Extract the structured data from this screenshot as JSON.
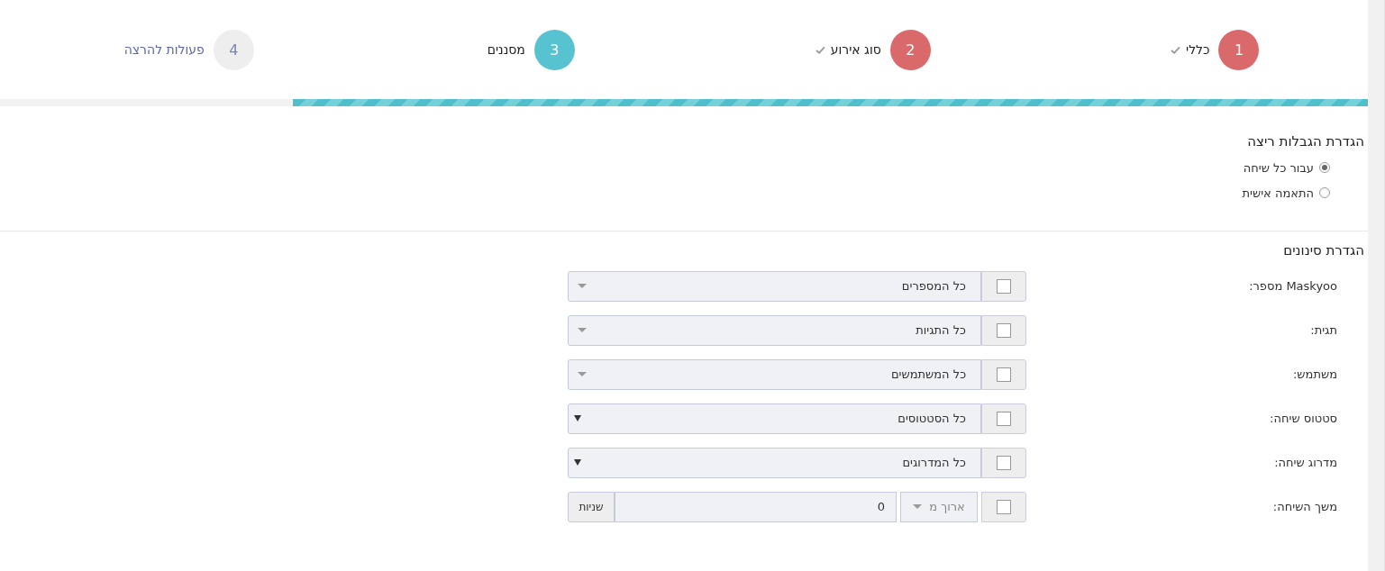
{
  "steps": [
    {
      "number": "1",
      "label": "כללי",
      "done": true,
      "selected": false
    },
    {
      "number": "2",
      "label": "סוג אירוע",
      "done": true,
      "selected": false
    },
    {
      "number": "3",
      "label": "מסננים",
      "done": false,
      "selected": true
    },
    {
      "number": "4",
      "label": "פעולות להרצה",
      "done": false,
      "selected": false
    }
  ],
  "progress": {
    "level": 0.786
  },
  "run_limits": {
    "title": "הגדרת הגבלות ריצה",
    "options": [
      {
        "label": "עבור כל שיחה",
        "selected": true
      },
      {
        "label": "התאמה אישית",
        "selected": false
      }
    ]
  },
  "filters": {
    "title": "הגדרת סינונים",
    "rows": [
      {
        "kind": "select",
        "label": "Maskyoo מספר:",
        "checked": false,
        "value": "כל המספרים"
      },
      {
        "kind": "select",
        "label": "תגית:",
        "checked": false,
        "value": "כל התגיות"
      },
      {
        "kind": "select",
        "label": "משתמש:",
        "checked": false,
        "value": "כל המשתמשים"
      },
      {
        "kind": "native-select",
        "label": "סטטוס שיחה:",
        "checked": false,
        "value": "כל הסטטוסים"
      },
      {
        "kind": "native-select",
        "label": "מדרוג שיחה:",
        "checked": false,
        "value": "כל המדרוגים"
      },
      {
        "kind": "duration",
        "label": "משך השיחה:",
        "checked": false,
        "operator": "ארוך מ",
        "value": "0",
        "unit": "שניות"
      }
    ]
  }
}
